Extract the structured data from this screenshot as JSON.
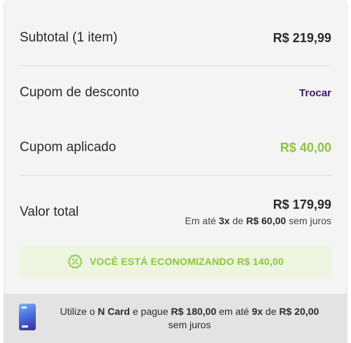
{
  "subtotal": {
    "label": "Subtotal (1 item)",
    "value": "R$ 219,99"
  },
  "coupon": {
    "label": "Cupom de desconto",
    "action": "Trocar"
  },
  "applied": {
    "label": "Cupom aplicado",
    "value": "R$ 40,00"
  },
  "total": {
    "label": "Valor total",
    "value": "R$ 179,99",
    "inst_prefix": "Em até ",
    "inst_count": "3x",
    "inst_mid": " de ",
    "inst_value": "R$ 60,00",
    "inst_suffix": " sem juros"
  },
  "savings": {
    "text": "VOCÊ ESTÁ ECONOMIZANDO R$ 140,00",
    "icon": "percent-badge-icon"
  },
  "ncard": {
    "prefix": "Utilize o ",
    "card_name": "N Card",
    "mid1": " e pague ",
    "amount": "R$ 180,00",
    "mid2": " em até ",
    "installments": "9x",
    "mid3": " de ",
    "installment_value": "R$ 20,00",
    "suffix": " sem juros",
    "icon": "ncard-card-icon"
  },
  "colors": {
    "accent_green": "#8cc63e",
    "link_purple": "#3e1a6e",
    "panel_bg": "#f4f4f4"
  }
}
